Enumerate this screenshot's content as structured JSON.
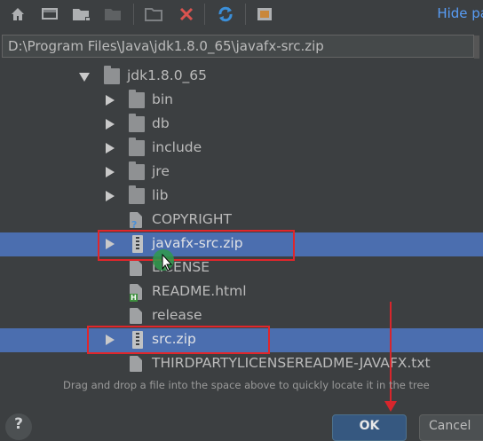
{
  "toolbar": {
    "icons": [
      "home-icon",
      "desktop-icon",
      "new-folder-icon",
      "new-folder-disabled-icon",
      "project-folder-icon",
      "delete-icon",
      "refresh-icon",
      "show-hidden-icon"
    ],
    "hide_path_label": "Hide pa",
    "colors": {
      "delete": "#d9534f",
      "refresh": "#3b8fd9",
      "link": "#589df6"
    }
  },
  "path": {
    "value": "D:\\Program Files\\Java\\jdk1.8.0_65\\javafx-src.zip"
  },
  "tree": {
    "rows": [
      {
        "label": "jdk1.8.0_65",
        "type": "folder",
        "expanded": true,
        "depth": 0
      },
      {
        "label": "bin",
        "type": "folder",
        "expanded": false,
        "depth": 1
      },
      {
        "label": "db",
        "type": "folder",
        "expanded": false,
        "depth": 1
      },
      {
        "label": "include",
        "type": "folder",
        "expanded": false,
        "depth": 1
      },
      {
        "label": "jre",
        "type": "folder",
        "expanded": false,
        "depth": 1
      },
      {
        "label": "lib",
        "type": "folder",
        "expanded": false,
        "depth": 1
      },
      {
        "label": "COPYRIGHT",
        "type": "file-unknown",
        "depth": 1
      },
      {
        "label": "javafx-src.zip",
        "type": "zip",
        "expanded": false,
        "selected": true,
        "depth": 1
      },
      {
        "label": "LICENSE",
        "type": "file",
        "depth": 1
      },
      {
        "label": "README.html",
        "type": "file-html",
        "depth": 1
      },
      {
        "label": "release",
        "type": "file",
        "depth": 1
      },
      {
        "label": "src.zip",
        "type": "zip",
        "expanded": false,
        "selected": true,
        "depth": 1
      },
      {
        "label": "THIRDPARTYLICENSEREADME-JAVAFX.txt",
        "type": "file",
        "depth": 1
      }
    ],
    "selection_color": "#4b6eaf",
    "highlight_color": "#e0262b"
  },
  "hint": "Drag and drop a file into the space above to quickly locate it in the tree",
  "footer": {
    "help_label": "?",
    "ok_label": "OK",
    "cancel_label": "Cancel"
  }
}
